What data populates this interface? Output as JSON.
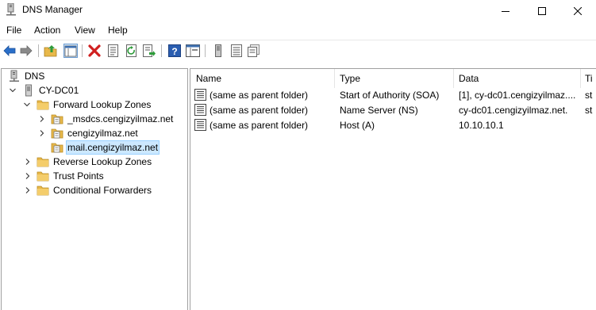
{
  "window": {
    "title": "DNS Manager"
  },
  "menu": {
    "items": [
      "File",
      "Action",
      "View",
      "Help"
    ]
  },
  "toolbar": {
    "buttons": [
      "back-icon",
      "forward-icon",
      "up-folder-icon",
      "show-hide-tree-icon",
      "delete-icon",
      "properties-icon",
      "refresh-icon",
      "export-list-icon",
      "help-icon",
      "console-tree-icon",
      "server-icon",
      "list-icon",
      "detail-icon"
    ]
  },
  "tree": {
    "root": "DNS",
    "server": "CY-DC01",
    "forward_zones": "Forward Lookup Zones",
    "zones": [
      "_msdcs.cengizyilmaz.net",
      "cengizyilmaz.net",
      "mail.cengizyilmaz.net"
    ],
    "reverse_zones": "Reverse Lookup Zones",
    "trust_points": "Trust Points",
    "conditional_forwarders": "Conditional Forwarders"
  },
  "list": {
    "columns": [
      "Name",
      "Type",
      "Data",
      "Ti"
    ],
    "rows": [
      {
        "name": "(same as parent folder)",
        "type": "Start of Authority (SOA)",
        "data": "[1], cy-dc01.cengizyilmaz....",
        "ts": "st"
      },
      {
        "name": "(same as parent folder)",
        "type": "Name Server (NS)",
        "data": "cy-dc01.cengizyilmaz.net.",
        "ts": "st"
      },
      {
        "name": "(same as parent folder)",
        "type": "Host (A)",
        "data": "10.10.10.1",
        "ts": ""
      }
    ]
  },
  "colors": {
    "selection": "#cce8ff",
    "selection_border": "#99d1ff",
    "folder": "#e8b84a",
    "accent": "#2a6fc9"
  }
}
